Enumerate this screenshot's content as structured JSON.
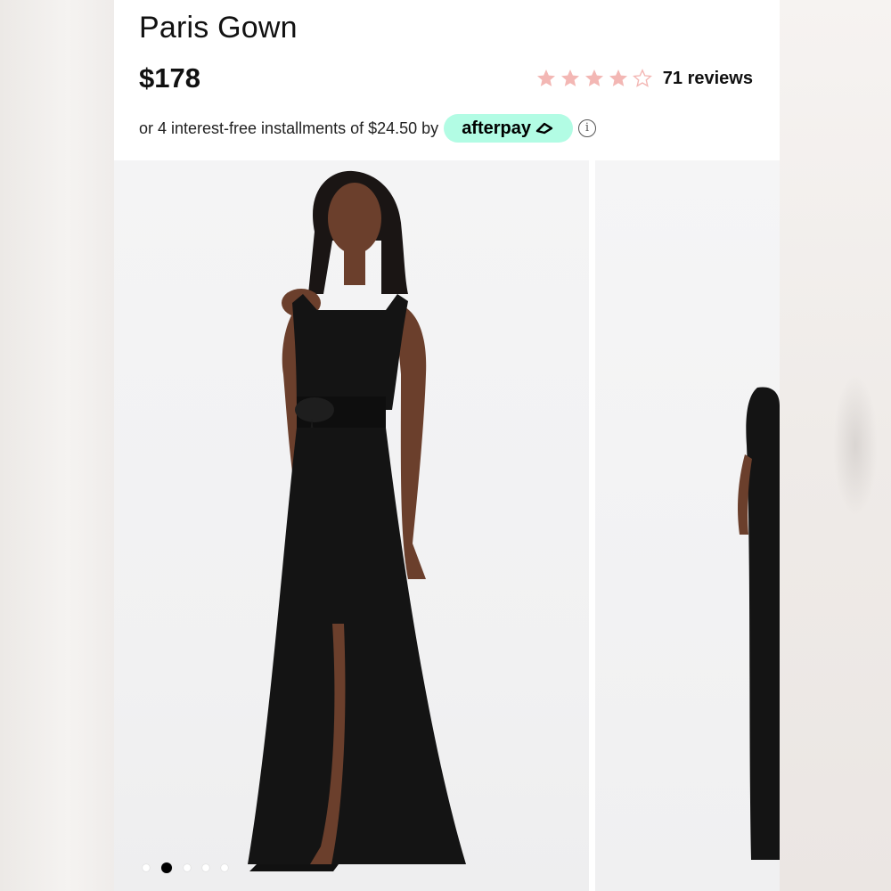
{
  "product": {
    "title": "Paris Gown",
    "price": "$178",
    "rating": {
      "stars_filled": 4,
      "stars_total": 5,
      "reviews_label": "71 reviews"
    }
  },
  "afterpay": {
    "installment_text": "or 4 interest-free installments of $24.50 by",
    "badge_label": "afterpay",
    "info_icon": "info-icon",
    "badge_color": "#b2fce4"
  },
  "gallery": {
    "slide_count": 5,
    "active_index": 1
  },
  "colors": {
    "star_filled": "#f3b7b4",
    "star_empty_outline": "#f3b7b4",
    "dress": "#141414"
  }
}
